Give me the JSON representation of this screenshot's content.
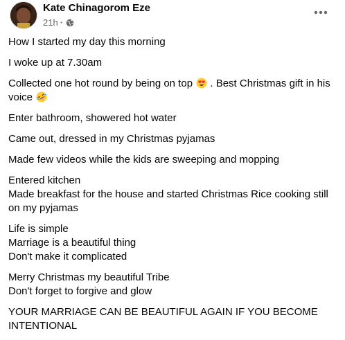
{
  "post": {
    "author": "Kate Chinagorom Eze",
    "time": "21h",
    "separator": "·",
    "audience_icon": "globe-icon",
    "more_icon": "more-options-icon",
    "paragraphs": [
      {
        "lines": [
          "How I started my day this morning"
        ]
      },
      {
        "lines": [
          "I woke up at 7.30am"
        ]
      },
      {
        "lines": [
          "Collected one hot round by being on top",
          " . Best Christmas gift in his",
          "voice "
        ]
      },
      {
        "lines": [
          "Enter bathroom, showered hot water"
        ]
      },
      {
        "lines": [
          "Came out, dressed in my Christmas pyjamas"
        ]
      },
      {
        "lines": [
          "Made few videos while the kids are sweeping and mopping"
        ]
      },
      {
        "lines": [
          "Entered kitchen",
          "Made breakfast for the house and started  Christmas Rice cooking still",
          "on my pyjamas"
        ]
      },
      {
        "lines": [
          "Life is simple",
          "Marriage is a beautiful thing",
          "Don't make it complicated"
        ]
      },
      {
        "lines": [
          "Merry Christmas my beautiful Tribe",
          "Don't forget to forgive and glow"
        ]
      },
      {
        "lines": [
          "YOUR MARRIAGE CAN BE BEAUTIFUL AGAIN IF YOU BECOME",
          "INTENTIONAL"
        ]
      }
    ],
    "emojis": {
      "heart_eyes": "heart-eyes-emoji",
      "laughing": "rolling-laughing-emoji"
    },
    "colors": {
      "text": "#050505",
      "meta": "#65676b",
      "emoji_face": "#ffcc33"
    }
  }
}
